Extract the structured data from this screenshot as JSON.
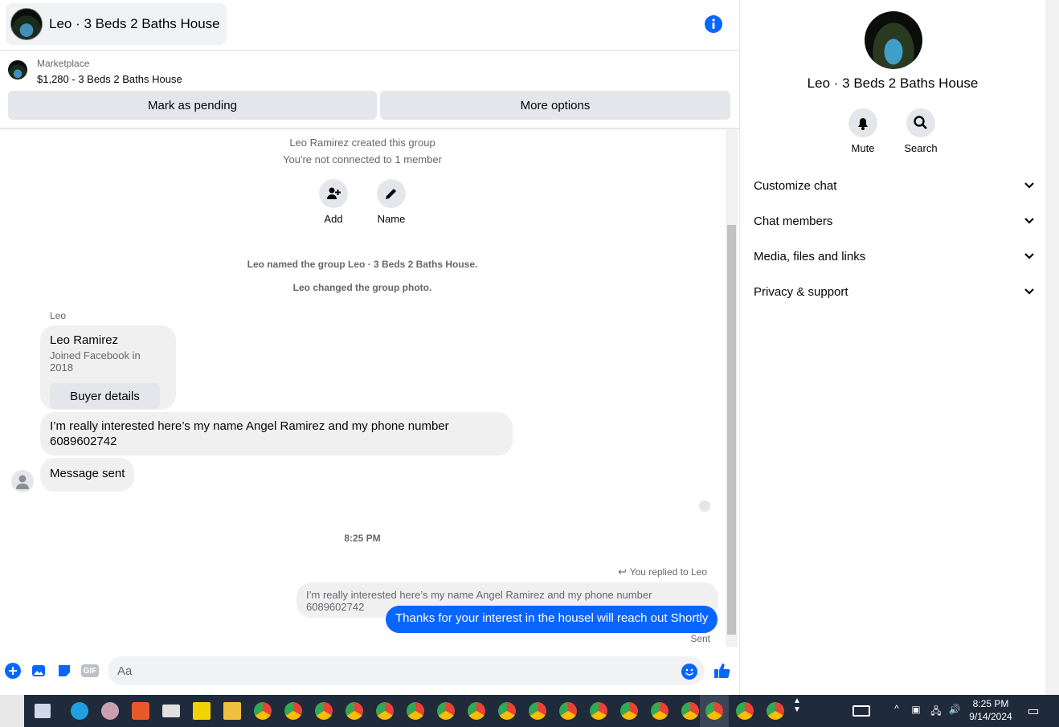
{
  "header": {
    "title": "Leo · 3 Beds 2 Baths House"
  },
  "listing": {
    "label": "Marketplace",
    "price_title": "$1,280 - 3 Beds 2 Baths House",
    "pending_button": "Mark as pending",
    "more_button": "More options"
  },
  "system": {
    "created": "Leo Ramirez created this group",
    "not_connected": "You're not connected to 1 member",
    "add_label": "Add",
    "name_label": "Name",
    "named": "Leo named the group Leo · 3 Beds 2 Baths House.",
    "photo": "Leo changed the group photo."
  },
  "messages": {
    "sender": "Leo",
    "card_name": "Leo Ramirez",
    "card_sub": "Joined Facebook in 2018",
    "card_button": "Buyer details",
    "msg1": "I’m really interested here’s my name Angel Ramirez and my phone number 6089602742",
    "msg2": "Message sent",
    "time": "8:25 PM",
    "replied": "You replied to Leo",
    "quoted": "I’m really interested here’s my name Angel Ramirez and my phone number 6089602742",
    "reply": "Thanks for your interest in the housel will reach out Shortly",
    "status": "Sent"
  },
  "composer": {
    "placeholder": "Aa",
    "gif": "GIF"
  },
  "side": {
    "title": "Leo · 3 Beds 2 Baths House",
    "mute": "Mute",
    "search": "Search",
    "rows": [
      "Customize chat",
      "Chat members",
      "Media, files and links",
      "Privacy & support"
    ]
  },
  "taskbar": {
    "time": "8:25 PM",
    "date": "9/14/2024"
  }
}
